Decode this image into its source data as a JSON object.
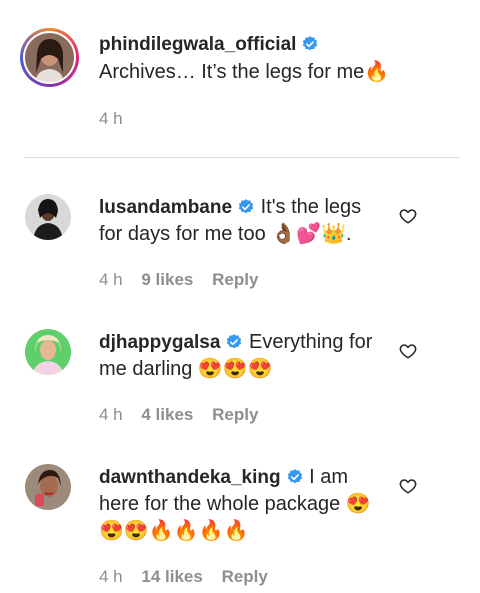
{
  "caption": {
    "username": "phindilegwala_official",
    "text": "Archives… It’s the legs for me🔥",
    "time": "4 h"
  },
  "comments": [
    {
      "username": "lusandambane",
      "text": "It's the legs for days for me too 👌🏾💕👑.",
      "time": "4 h",
      "likes": "9 likes",
      "reply": "Reply"
    },
    {
      "username": "djhappygalsa",
      "text": "Everything for me darling 😍😍😍",
      "time": "4 h",
      "likes": "4 likes",
      "reply": "Reply"
    },
    {
      "username": "dawnthandeka_king",
      "text": "I am here for the whole package 😍😍😍🔥🔥🔥🔥",
      "time": "4 h",
      "likes": "14 likes",
      "reply": "Reply"
    }
  ],
  "colors": {
    "verified": "#3897f0",
    "meta": "#8e8e8e",
    "text": "#262626"
  }
}
